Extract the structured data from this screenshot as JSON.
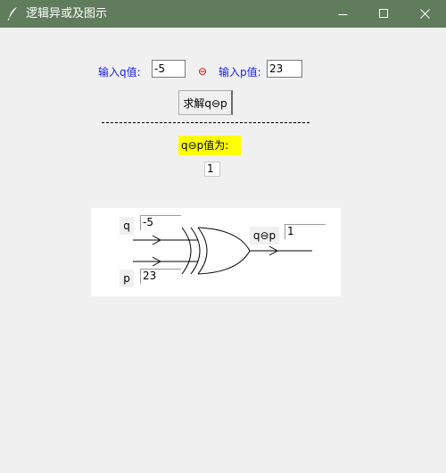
{
  "window": {
    "title": "逻辑异或及图示"
  },
  "inputs": {
    "q_label": "输入q值:",
    "q_value": "-5",
    "xor_symbol": "⊖",
    "p_label": "输入p值:",
    "p_value": "23"
  },
  "solve_button": {
    "label": "求解q⊖p"
  },
  "result": {
    "label": "q⊖p值为:",
    "value": "1"
  },
  "diagram": {
    "q_label": "q",
    "q_value": "-5",
    "p_label": "p",
    "p_value": "23",
    "output_label": "q⊖p",
    "output_value": "1"
  },
  "colors": {
    "titlebar": "#617c5d",
    "label_blue": "#1c1cf0",
    "xor_red": "#e00000",
    "result_highlight": "#ffff00"
  },
  "icons": {
    "app": "feather-icon",
    "minimize": "minimize-icon",
    "maximize": "maximize-icon",
    "close": "close-icon"
  }
}
